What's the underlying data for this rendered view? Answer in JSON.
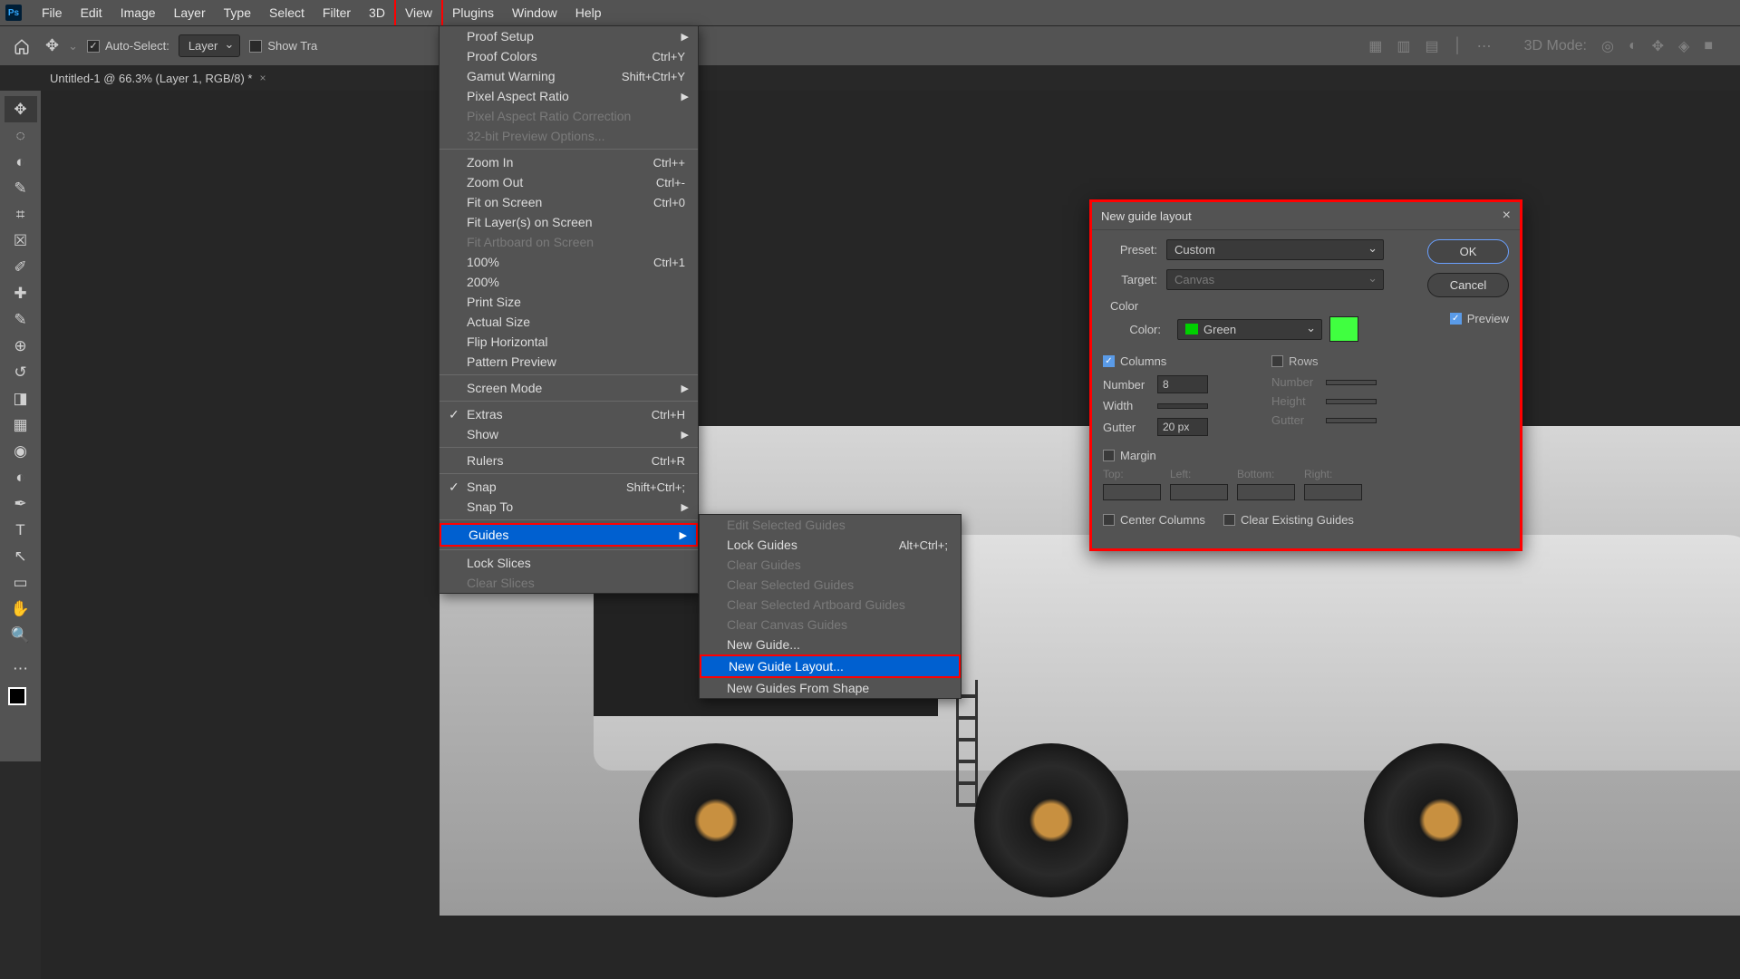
{
  "menubar": {
    "items": [
      "File",
      "Edit",
      "Image",
      "Layer",
      "Type",
      "Select",
      "Filter",
      "3D",
      "View",
      "Plugins",
      "Window",
      "Help"
    ],
    "highlighted": "View"
  },
  "options": {
    "auto_select": "Auto-Select:",
    "layer_dropdown": "Layer",
    "show_transform": "Show Tra",
    "three_d_mode": "3D Mode:"
  },
  "tab": {
    "title": "Untitled-1 @ 66.3% (Layer 1, RGB/8) *"
  },
  "viewMenu": {
    "items": [
      {
        "label": "Proof Setup",
        "submenu": true
      },
      {
        "label": "Proof Colors",
        "shortcut": "Ctrl+Y"
      },
      {
        "label": "Gamut Warning",
        "shortcut": "Shift+Ctrl+Y"
      },
      {
        "label": "Pixel Aspect Ratio",
        "submenu": true
      },
      {
        "label": "Pixel Aspect Ratio Correction",
        "disabled": true
      },
      {
        "label": "32-bit Preview Options...",
        "disabled": true
      },
      {
        "sep": true
      },
      {
        "label": "Zoom In",
        "shortcut": "Ctrl++"
      },
      {
        "label": "Zoom Out",
        "shortcut": "Ctrl+-"
      },
      {
        "label": "Fit on Screen",
        "shortcut": "Ctrl+0"
      },
      {
        "label": "Fit Layer(s) on Screen"
      },
      {
        "label": "Fit Artboard on Screen",
        "disabled": true
      },
      {
        "label": "100%",
        "shortcut": "Ctrl+1"
      },
      {
        "label": "200%"
      },
      {
        "label": "Print Size"
      },
      {
        "label": "Actual Size"
      },
      {
        "label": "Flip Horizontal"
      },
      {
        "label": "Pattern Preview"
      },
      {
        "sep": true
      },
      {
        "label": "Screen Mode",
        "submenu": true
      },
      {
        "sep": true
      },
      {
        "label": "Extras",
        "shortcut": "Ctrl+H",
        "checked": true
      },
      {
        "label": "Show",
        "submenu": true
      },
      {
        "sep": true
      },
      {
        "label": "Rulers",
        "shortcut": "Ctrl+R"
      },
      {
        "sep": true
      },
      {
        "label": "Snap",
        "shortcut": "Shift+Ctrl+;",
        "checked": true
      },
      {
        "label": "Snap To",
        "submenu": true
      },
      {
        "sep": true
      },
      {
        "label": "Guides",
        "submenu": true,
        "highlighted": true
      },
      {
        "sep": true
      },
      {
        "label": "Lock Slices"
      },
      {
        "label": "Clear Slices",
        "disabled": true
      }
    ]
  },
  "guidesSubmenu": {
    "items": [
      {
        "label": "Edit Selected Guides",
        "disabled": true
      },
      {
        "label": "Lock Guides",
        "shortcut": "Alt+Ctrl+;"
      },
      {
        "label": "Clear Guides",
        "disabled": true
      },
      {
        "label": "Clear Selected Guides",
        "disabled": true
      },
      {
        "label": "Clear Selected Artboard Guides",
        "disabled": true
      },
      {
        "label": "Clear Canvas Guides",
        "disabled": true
      },
      {
        "label": "New Guide..."
      },
      {
        "label": "New Guide Layout...",
        "highlighted": true
      },
      {
        "label": "New Guides From Shape"
      }
    ]
  },
  "dialog": {
    "title": "New guide layout",
    "preset_label": "Preset:",
    "preset_value": "Custom",
    "target_label": "Target:",
    "target_value": "Canvas",
    "ok": "OK",
    "cancel": "Cancel",
    "preview": "Preview",
    "color_section": "Color",
    "color_label": "Color:",
    "color_value": "Green",
    "columns_label": "Columns",
    "rows_label": "Rows",
    "number_label": "Number",
    "number_value": "8",
    "width_label": "Width",
    "height_label": "Height",
    "gutter_label": "Gutter",
    "gutter_value": "20 px",
    "margin_label": "Margin",
    "top": "Top:",
    "left": "Left:",
    "bottom": "Bottom:",
    "right": "Right:",
    "center_columns": "Center Columns",
    "clear_existing": "Clear Existing Guides"
  },
  "tools": [
    "move",
    "marquee",
    "lasso",
    "magic-wand",
    "crop",
    "frame",
    "eyedropper",
    "healing",
    "brush",
    "clone",
    "history-brush",
    "eraser",
    "gradient",
    "blur",
    "dodge",
    "pen",
    "type",
    "path-select",
    "rectangle",
    "hand",
    "zoom"
  ]
}
